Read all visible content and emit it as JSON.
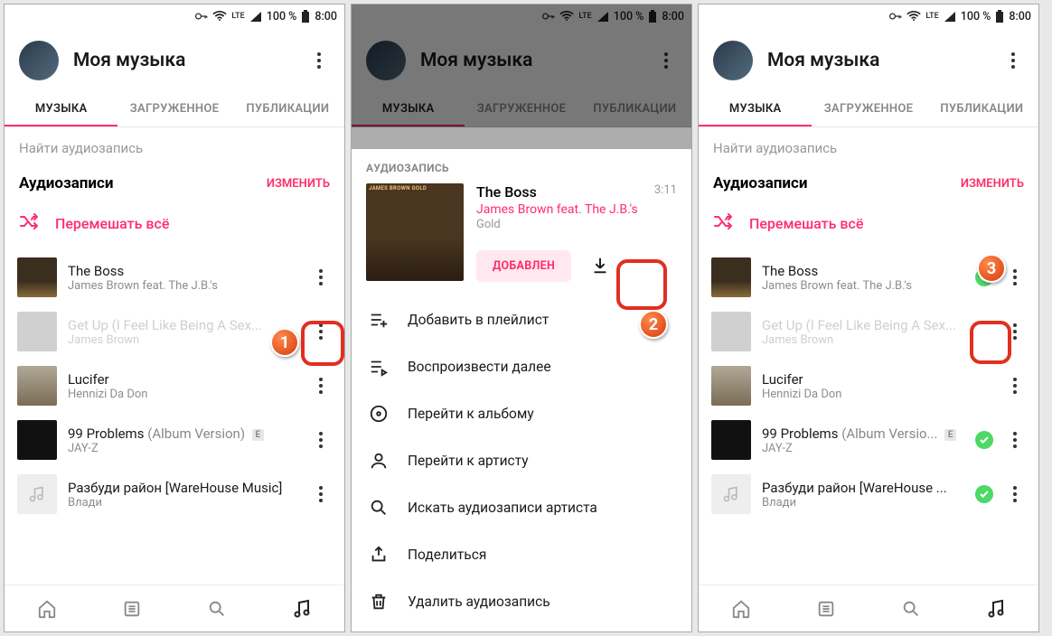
{
  "status": {
    "signal": "LTE",
    "battery": "100 %",
    "time": "8:00"
  },
  "header": {
    "title": "Моя музыка"
  },
  "tabs": [
    "МУЗЫКА",
    "ЗАГРУЖЕННОЕ",
    "ПУБЛИКАЦИИ"
  ],
  "search_placeholder": "Найти аудиозапись",
  "section_title": "Аудиозаписи",
  "edit_label": "ИЗМЕНИТЬ",
  "shuffle_label": "Перемешать всё",
  "tracks": [
    {
      "title": "The Boss",
      "artist": "James Brown feat. The J.B.'s"
    },
    {
      "title": "Get Up (I Feel Like Being A Sex...",
      "artist": "James Brown"
    },
    {
      "title": "Lucifer",
      "artist": "Hennizi Da Don"
    },
    {
      "title": "99 Problems",
      "version": "(Album Version)",
      "artist": "JAY-Z",
      "explicit": "E"
    },
    {
      "title": "Разбуди район [WareHouse Music]",
      "artist": "Влади"
    }
  ],
  "tracks3": [
    {
      "title": "The Boss",
      "artist": "James Brown feat. The J.B.'s"
    },
    {
      "title": "Get Up (I Feel Like Being A Sex...",
      "artist": "James Brown"
    },
    {
      "title": "Lucifer",
      "artist": "Hennizi Da Don"
    },
    {
      "title": "99 Problems",
      "version": "(Album Versio...",
      "artist": "JAY-Z",
      "explicit": "E"
    },
    {
      "title": "Разбуди район [WareHouse ...",
      "artist": "Влади"
    }
  ],
  "sheet": {
    "label": "АУДИОЗАПИСЬ",
    "title": "The Boss",
    "duration": "3:11",
    "artist": "James Brown feat. The J.B.'s",
    "album": "Gold",
    "added_label": "ДОБАВЛЕН",
    "menu": [
      "Добавить в плейлист",
      "Воспроизвести далее",
      "Перейти к альбому",
      "Перейти к артисту",
      "Искать аудиозаписи артиста",
      "Поделиться",
      "Удалить аудиозапись"
    ]
  },
  "badges": {
    "b1": "1",
    "b2": "2",
    "b3": "3"
  }
}
